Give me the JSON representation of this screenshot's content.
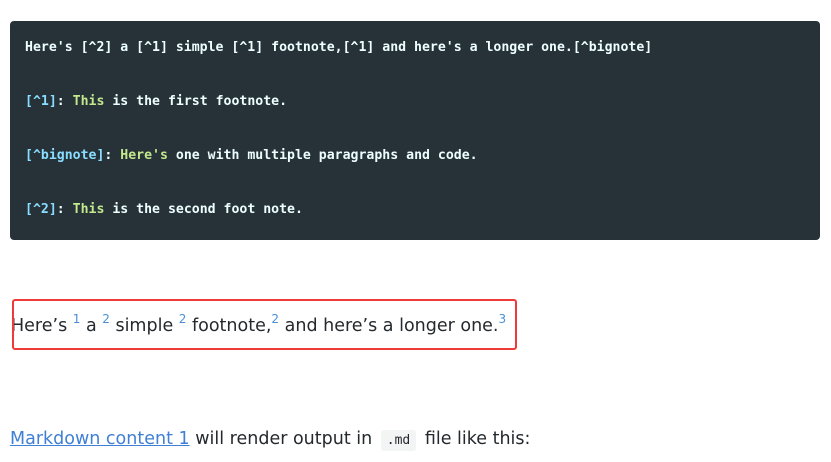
{
  "code_block": {
    "lines": [
      {
        "parts": [
          {
            "text": "Here's [^2] a [^1] simple [^1] footnote,[^1] and here's a longer one.[^bignote]",
            "kind": "plain"
          }
        ]
      },
      {
        "parts": [
          {
            "text": "[^1]",
            "kind": "ref"
          },
          {
            "text": ": ",
            "kind": "plain"
          },
          {
            "text": "This",
            "kind": "kw"
          },
          {
            "text": " is the first footnote.",
            "kind": "plain"
          }
        ]
      },
      {
        "parts": [
          {
            "text": "[^bignote]",
            "kind": "ref"
          },
          {
            "text": ": ",
            "kind": "plain"
          },
          {
            "text": "Here's",
            "kind": "kw"
          },
          {
            "text": " one with multiple paragraphs and code.",
            "kind": "plain"
          }
        ]
      },
      {
        "parts": [
          {
            "text": "[^2]",
            "kind": "ref"
          },
          {
            "text": ": ",
            "kind": "plain"
          },
          {
            "text": "This",
            "kind": "kw"
          },
          {
            "text": " is the second foot note.",
            "kind": "plain"
          }
        ]
      }
    ]
  },
  "rendered_preview": {
    "segments": [
      {
        "text": "Here’s ",
        "sup": "1"
      },
      {
        "text": " a ",
        "sup": "2"
      },
      {
        "text": " simple ",
        "sup": "2"
      },
      {
        "text": " footnote,",
        "sup": "2"
      },
      {
        "text": " and here’s a longer one.",
        "sup": "3"
      }
    ]
  },
  "bottom_text": {
    "link": "Markdown content 1",
    "middle": " will render output in ",
    "code": ".md",
    "end": " file like this:"
  },
  "colors": {
    "code_background": "#263238",
    "highlight_border": "#f03a3a",
    "link": "#3f7fd6"
  }
}
